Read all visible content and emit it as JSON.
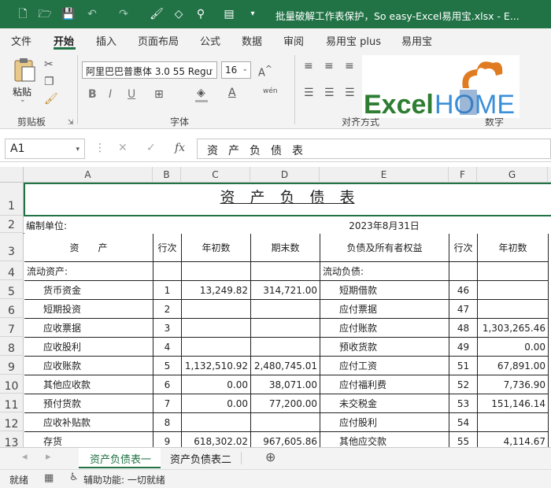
{
  "window": {
    "title": "批量破解工作表保护，So easy-Excel易用宝.xlsx - E..."
  },
  "menu_tabs": [
    "文件",
    "开始",
    "插入",
    "页面布局",
    "公式",
    "数据",
    "审阅",
    "易用宝 plus",
    "易用宝"
  ],
  "ribbon": {
    "paste_label": "粘贴",
    "clipboard_label": "剪贴板",
    "font_group_label": "字体",
    "align_group_label": "对齐方式",
    "number_group_label": "数字",
    "font_name": "阿里巴巴普惠体 3.0 55 Regu",
    "font_size": "16",
    "bold": "B",
    "italic": "I",
    "underline": "U",
    "wen_label": "wén",
    "logo_text_1": "Excel",
    "logo_text_2": "HOME"
  },
  "formula_bar": {
    "name_box": "A1",
    "fx": "fx",
    "content": "资产负债表"
  },
  "columns": [
    "A",
    "B",
    "C",
    "D",
    "E",
    "F",
    "G"
  ],
  "rows": [
    "1",
    "2",
    "3",
    "4",
    "5",
    "6",
    "7",
    "8",
    "9",
    "10",
    "11",
    "12",
    "13"
  ],
  "sheet": {
    "title": "资　产　负　债　表",
    "unit_label": "编制单位:",
    "date": "2023年8月31日",
    "headers": [
      "资　　产",
      "行次",
      "年初数",
      "期末数",
      "负债及所有者权益",
      "行次",
      "年初数"
    ],
    "data": [
      [
        "流动资产:",
        "",
        "",
        "",
        "流动负债:",
        "",
        ""
      ],
      [
        "货币资金",
        "1",
        "13,249.82",
        "314,721.00",
        "短期借款",
        "46",
        ""
      ],
      [
        "短期投资",
        "2",
        "",
        "",
        "应付票据",
        "47",
        ""
      ],
      [
        "应收票据",
        "3",
        "",
        "",
        "应付账款",
        "48",
        "1,303,265.46"
      ],
      [
        "应收股利",
        "4",
        "",
        "",
        "预收货款",
        "49",
        "0.00"
      ],
      [
        "应收账款",
        "5",
        "1,132,510.92",
        "2,480,745.01",
        "应付工资",
        "51",
        "67,891.00"
      ],
      [
        "其他应收款",
        "6",
        "0.00",
        "38,071.00",
        "应付福利费",
        "52",
        "7,736.90"
      ],
      [
        "预付货款",
        "7",
        "0.00",
        "77,200.00",
        "未交税金",
        "53",
        "151,146.14"
      ],
      [
        "应收补贴款",
        "8",
        "",
        "",
        "应付股利",
        "54",
        ""
      ],
      [
        "存货",
        "9",
        "618,302.02",
        "967,605.86",
        "其他应交款",
        "55",
        "4,114.67"
      ]
    ]
  },
  "sheet_tabs": [
    "资产负债表一",
    "资产负债表二"
  ],
  "status": {
    "ready": "就绪",
    "accessibility": "辅助功能: 一切就绪"
  },
  "colors": {
    "accent": "#217346"
  }
}
